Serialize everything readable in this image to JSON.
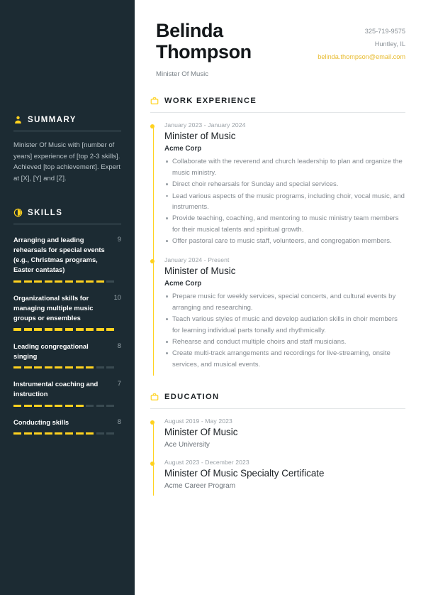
{
  "theme": {
    "sidebar_bg": "#1c2b33",
    "accent": "#ffd21f",
    "email_color": "#e8bb2e",
    "page_bg": "#ffffff"
  },
  "header": {
    "first_name": "Belinda",
    "last_name": "Thompson",
    "role": "Minister Of Music",
    "phone": "325-719-9575",
    "location": "Huntley, IL",
    "email": "belinda.thompson@email.com"
  },
  "sidebar": {
    "summary": {
      "icon": "user-icon",
      "title": "SUMMARY",
      "text": "Minister Of Music with [number of years] experience of [top 2-3 skills]. Achieved [top achievement]. Expert at [X], [Y] and [Z]."
    },
    "skills": {
      "icon": "skill-meter-icon",
      "title": "SKILLS",
      "max": 10,
      "items": [
        {
          "name": "Arranging and leading rehearsals for special events (e.g., Christmas programs, Easter cantatas)",
          "rating": 9
        },
        {
          "name": "Organizational skills for managing multiple music groups or ensembles",
          "rating": 10
        },
        {
          "name": "Leading congregational singing",
          "rating": 8
        },
        {
          "name": "Instrumental coaching and instruction",
          "rating": 7
        },
        {
          "name": "Conducting skills",
          "rating": 8
        }
      ]
    }
  },
  "main": {
    "work": {
      "icon": "briefcase-icon",
      "title": "WORK EXPERIENCE",
      "entries": [
        {
          "dates": "January 2023 - January 2024",
          "title": "Minister of Music",
          "org": "Acme Corp",
          "bullets": [
            "Collaborate with the reverend and church leadership to plan and organize the music ministry.",
            "Direct choir rehearsals for Sunday and special services.",
            "Lead various aspects of the music programs, including choir, vocal music, and instruments.",
            "Provide teaching, coaching, and mentoring to music ministry team members for their musical talents and spiritual growth.",
            "Offer pastoral care to music staff, volunteers, and congregation members."
          ]
        },
        {
          "dates": "January 2024 - Present",
          "title": "Minister of Music",
          "org": "Acme Corp",
          "bullets": [
            "Prepare music for weekly services, special concerts, and cultural events by arranging and researching.",
            "Teach various styles of music and develop audiation skills in choir members for learning individual parts tonally and rhythmically.",
            "Rehearse and conduct multiple choirs and staff musicians.",
            "Create multi-track arrangements and recordings for live-streaming, onsite services, and musical events."
          ]
        }
      ]
    },
    "education": {
      "icon": "briefcase-icon",
      "title": "EDUCATION",
      "entries": [
        {
          "dates": "August 2019 - May 2023",
          "title": "Minister Of Music",
          "org": "Ace University"
        },
        {
          "dates": "August 2023 - December 2023",
          "title": "Minister Of Music Specialty Certificate",
          "org": "Acme Career Program"
        }
      ]
    }
  }
}
